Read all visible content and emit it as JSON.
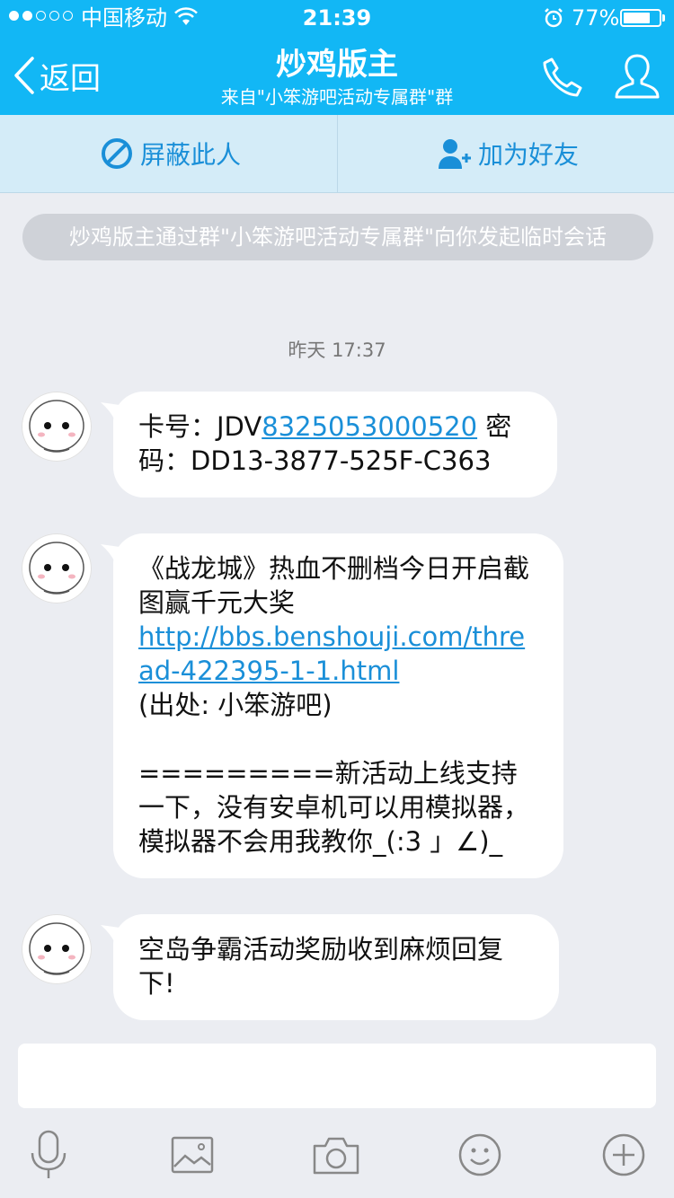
{
  "status_bar": {
    "carrier": "中国移动",
    "time": "21:39",
    "battery_percent": "77%",
    "battery_level": 0.77,
    "signal_bars_filled": 2,
    "signal_bars_total": 5
  },
  "nav": {
    "back_label": "返回",
    "title": "炒鸡版主",
    "subtitle": "来自\"小笨游吧活动专属群\"群",
    "phone_icon": "phone-icon",
    "profile_icon": "profile-icon"
  },
  "actions": {
    "block_label": "屏蔽此人",
    "block_icon": "block-icon",
    "add_friend_label": "加为好友",
    "add_friend_icon": "add-friend-icon"
  },
  "system_notice": "炒鸡版主通过群\"小笨游吧活动专属群\"向你发起临时会话",
  "timestamp": "昨天 17:37",
  "messages": [
    {
      "prefix": "卡号：JDV",
      "link": "8325053000520",
      "suffix": " 密码：DD13-3877-525F-C363"
    },
    {
      "line1": "《战龙城》热血不删档今日开启截图赢千元大奖",
      "link": "http://bbs.benshouji.com/thread-422395-1-1.html",
      "source": "(出处: 小笨游吧)",
      "body": "=========新活动上线支持一下，没有安卓机可以用模拟器，模拟器不会用我教你_(:3 」∠)_"
    },
    {
      "text": "空岛争霸活动奖励收到麻烦回复下!"
    }
  ],
  "toolbar": {
    "icons": [
      "microphone-icon",
      "image-icon",
      "camera-icon",
      "emoji-icon",
      "plus-icon"
    ]
  },
  "colors": {
    "header": "#12b7f5",
    "action_bar": "#d4ecf8",
    "accent": "#1a8fd8",
    "background": "#ebedf2",
    "notice": "#cfd2d8"
  }
}
